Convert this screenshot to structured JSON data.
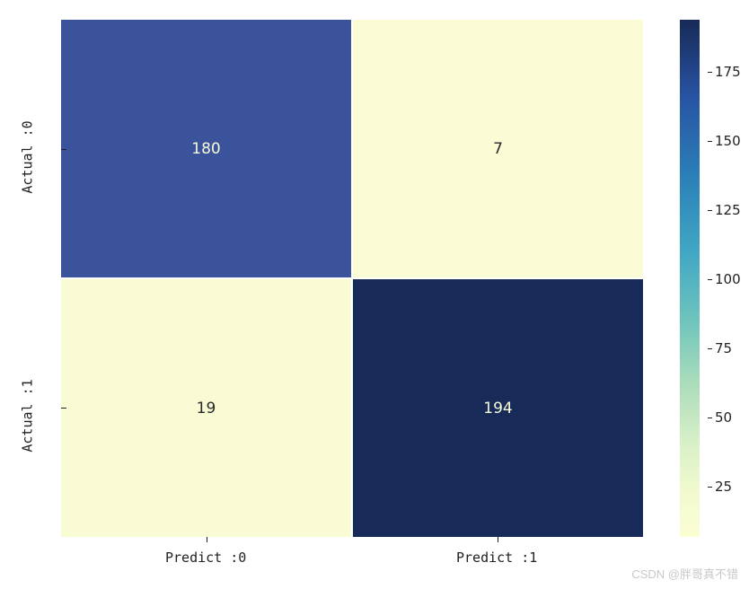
{
  "chart_data": {
    "type": "heatmap",
    "title": "",
    "xlabel": "",
    "ylabel": "",
    "x_categories": [
      "Predict :0",
      "Predict :1"
    ],
    "y_categories": [
      "Actual :0",
      "Actual :1"
    ],
    "values": [
      [
        180,
        7
      ],
      [
        19,
        194
      ]
    ],
    "colorbar": {
      "range": [
        7,
        194
      ],
      "ticks": [
        25,
        50,
        75,
        100,
        125,
        150,
        175
      ]
    },
    "colormap": "YlGnBu"
  },
  "cells": {
    "r0c0": "180",
    "r0c1": "7",
    "r1c0": "19",
    "r1c1": "194"
  },
  "axis": {
    "y0": "Actual :0",
    "y1": "Actual :1",
    "x0": "Predict :0",
    "x1": "Predict :1"
  },
  "colorbar_ticks": {
    "t25": "25",
    "t50": "50",
    "t75": "75",
    "t100": "100",
    "t125": "125",
    "t150": "150",
    "t175": "175"
  },
  "watermark": "CSDN @胖哥真不错"
}
